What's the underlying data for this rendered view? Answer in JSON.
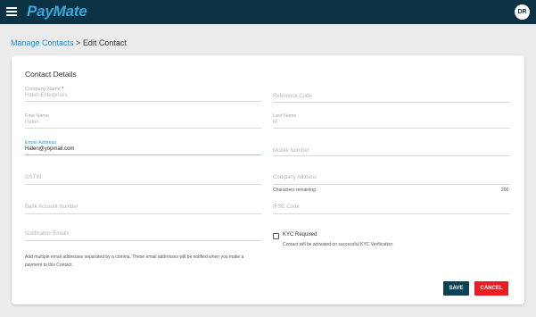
{
  "header": {
    "brand": "PayMate",
    "avatar_initials": "DR",
    "bar_color": "#0c3344",
    "brand_color": "#3aa7dc"
  },
  "breadcrumb": {
    "parent": "Manage Contacts",
    "separator": " > ",
    "current": "Edit Contact"
  },
  "form": {
    "title": "Contact Details",
    "company_name": {
      "label": "Company Name",
      "required_mark": "*",
      "value": "Halen Enterprises"
    },
    "reference_code": {
      "placeholder": "Reference Code"
    },
    "first_name": {
      "label": "First Name",
      "value": "Halen"
    },
    "last_name": {
      "label": "Last Name",
      "value": "M"
    },
    "email": {
      "label": "Email Address",
      "value": "Halen@yopmail.com"
    },
    "mobile": {
      "placeholder": "Mobile Number"
    },
    "gstin": {
      "placeholder": "GSTIN"
    },
    "company_address": {
      "placeholder": "Company Address",
      "chars_label": "Characters remaining",
      "chars_count": "200"
    },
    "bank_account": {
      "placeholder": "Bank Account Number"
    },
    "ifsc": {
      "placeholder": "IFSC Code"
    },
    "notification_emails": {
      "placeholder": "Notification Emails",
      "hint_line1": "Add multiple email addresses separated by a comma. These email addresses will be notified when you make a",
      "hint_line2": "payment to this Contact."
    },
    "kyc": {
      "label": "KYC Required",
      "checked": false,
      "note": "Contact will be activated on successful KYC Verification."
    }
  },
  "actions": {
    "save_label": "SAVE",
    "cancel_label": "CANCEL",
    "save_color": "#0c4156",
    "cancel_color": "#e81e22"
  }
}
